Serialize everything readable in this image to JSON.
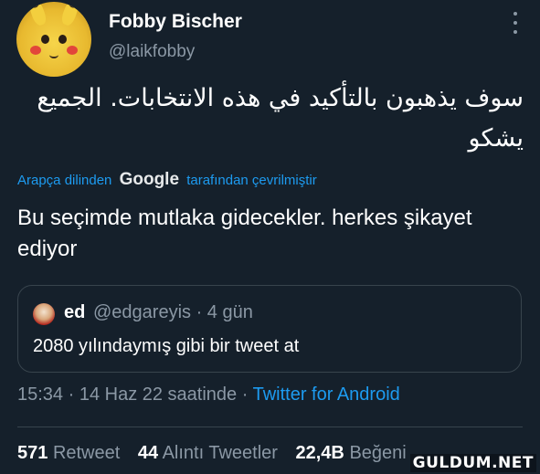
{
  "tweet": {
    "display_name": "Fobby Bischer",
    "handle": "@laikfobby",
    "text_arabic": "سوف يذهبون بالتأكيد في هذه الانتخابات. الجميع يشكو",
    "translated_prefix": "Arapça dilinden",
    "translated_engine": "Google",
    "translated_suffix": "tarafından çevrilmiştir",
    "translation": "Bu seçimde mutlaka gidecekler. herkes şikayet ediyor",
    "timestamp": "15:34 · 14 Haz 22 saatinde · ",
    "source": "Twitter for Android"
  },
  "quoted": {
    "name": "ed",
    "meta": "@edgareyis · 4 gün",
    "text": "2080 yılındaymış gibi bir tweet at"
  },
  "stats": {
    "retweets_count": "571",
    "retweets_label": "Retweet",
    "quotes_count": "44",
    "quotes_label": "Alıntı Tweetler",
    "likes_count": "22,4B",
    "likes_label": "Beğeni"
  },
  "watermark": "GULDUM.NET",
  "icons": {
    "more": "more-vertical-icon"
  }
}
